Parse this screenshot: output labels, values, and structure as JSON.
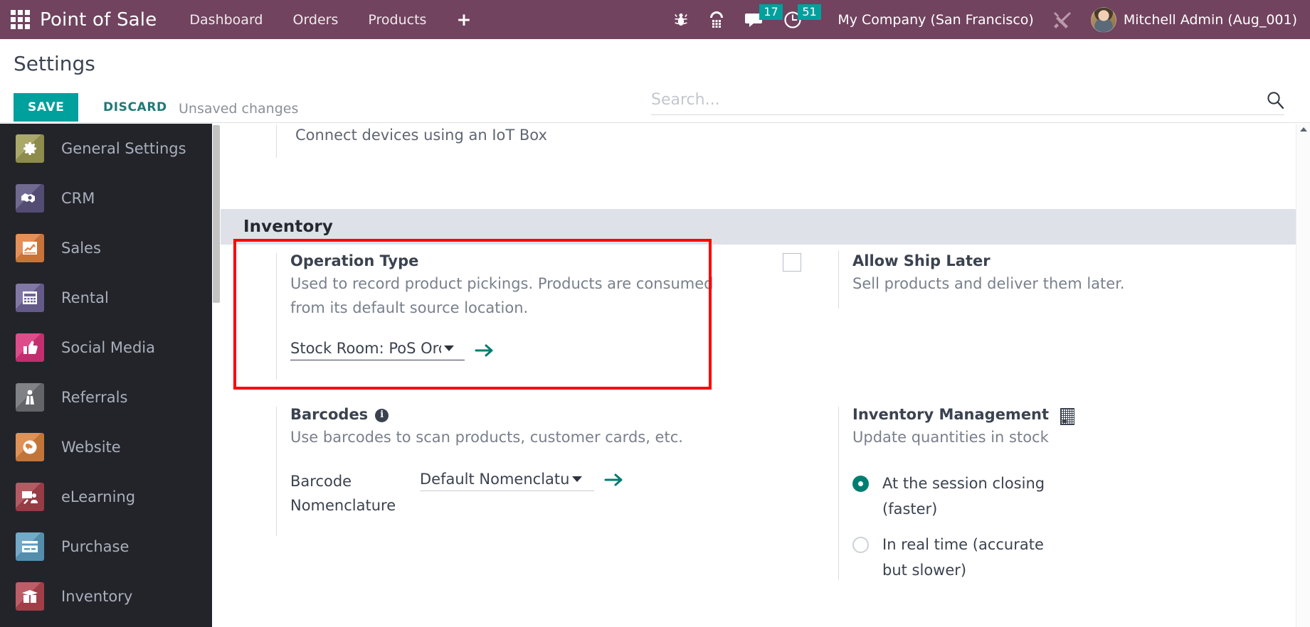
{
  "navbar": {
    "apps_icon": "apps-grid-icon",
    "brand": "Point of Sale",
    "menu": [
      {
        "label": "Dashboard"
      },
      {
        "label": "Orders"
      },
      {
        "label": "Products"
      }
    ],
    "plus_label": "+",
    "systray": [
      {
        "icon": "bug-icon",
        "name": "debug-bug-icon",
        "badge": null
      },
      {
        "icon": "dialpad-phone-icon",
        "name": "voip-phone-icon",
        "badge": null
      },
      {
        "icon": "chat-bubble-icon",
        "name": "messages-icon",
        "badge": "17"
      },
      {
        "icon": "clock-icon",
        "name": "activities-icon",
        "badge": "51"
      }
    ],
    "company": "My Company (San Francisco)",
    "tools_icon": "tools-wrench-screwdriver-icon",
    "user": "Mitchell Admin (Aug_001)"
  },
  "control_panel": {
    "title": "Settings",
    "save_label": "SAVE",
    "discard_label": "DISCARD",
    "unsaved_text": "Unsaved changes",
    "search_placeholder": "Search...",
    "search_value": "",
    "search_icon": "search-icon"
  },
  "sidebar": {
    "items": [
      {
        "label": "General Settings",
        "icon": "gear-icon",
        "color": "#9e9c54"
      },
      {
        "label": "CRM",
        "icon": "handshake-icon",
        "color": "#5c5480"
      },
      {
        "label": "Sales",
        "icon": "chart-up-icon",
        "color": "#e0803f"
      },
      {
        "label": "Rental",
        "icon": "calendar-icon",
        "color": "#6f6499"
      },
      {
        "label": "Social Media",
        "icon": "thumbs-up-icon",
        "color": "#d9337a"
      },
      {
        "label": "Referrals",
        "icon": "person-gift-icon",
        "color": "#6d6f74"
      },
      {
        "label": "Website",
        "icon": "globe-icon",
        "color": "#d9823f"
      },
      {
        "label": "eLearning",
        "icon": "presenter-icon",
        "color": "#a8424c"
      },
      {
        "label": "Purchase",
        "icon": "card-icon",
        "color": "#5d9ec0"
      },
      {
        "label": "Inventory",
        "icon": "open-box-icon",
        "color": "#b34550"
      }
    ]
  },
  "content": {
    "iot_text": "Connect devices using an IoT Box",
    "section_title": "Inventory",
    "operation_type": {
      "title": "Operation Type",
      "description": "Used to record product pickings. Products are consumed from its default source location.",
      "select_value": "Stock Room: PoS Orde",
      "internal_link_icon": "internal-link-arrow-icon",
      "highlighted": true
    },
    "barcodes": {
      "title": "Barcodes",
      "info_icon": "info-icon",
      "info_glyph": "i",
      "description": "Use barcodes to scan products, customer cards, etc.",
      "field_label": "Barcode Nomenclature",
      "select_value": "Default Nomenclatu",
      "internal_link_icon": "internal-link-arrow-icon"
    },
    "allow_ship_later": {
      "title": "Allow Ship Later",
      "description": "Sell products and deliver them later.",
      "checked": false
    },
    "inventory_management": {
      "title": "Inventory Management",
      "icon": "mini-grid-icon",
      "description": "Update quantities in stock",
      "options": [
        {
          "label": "At the session closing (faster)",
          "selected": true
        },
        {
          "label": "In real time (accurate but slower)",
          "selected": false
        }
      ]
    }
  },
  "colors": {
    "navbar_bg": "#71435f",
    "accent_teal": "#00a09d",
    "highlight_red": "#ff0000",
    "sidebar_bg": "#23242a",
    "section_band_bg": "#dfe1e8"
  }
}
